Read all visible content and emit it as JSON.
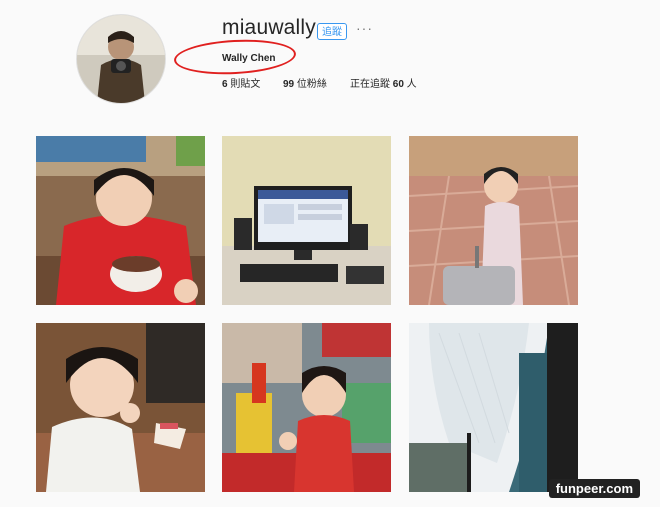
{
  "profile": {
    "username": "miauwally",
    "follow_label": "追蹤",
    "more_label": "...",
    "full_name": "Wally Chen",
    "posts_prefix": "6",
    "posts_suffix": " 則貼文",
    "followers_prefix": "99",
    "followers_suffix": " 位粉絲",
    "following_label": "正在追蹤 ",
    "following_count": "60",
    "following_suffix": " 人"
  },
  "posts": [
    {
      "subject": "girl in red jacket eating from bowl"
    },
    {
      "subject": "computer monitor with keyboard and speakers"
    },
    {
      "subject": "girl with suitcase on tiled floor"
    },
    {
      "subject": "girl eating cake"
    },
    {
      "subject": "girl playing with toys"
    },
    {
      "subject": "sky and buildings view"
    }
  ],
  "watermark": "funpeer.com",
  "colors": {
    "accent": "#3897f0",
    "annotation": "#e0201f"
  }
}
